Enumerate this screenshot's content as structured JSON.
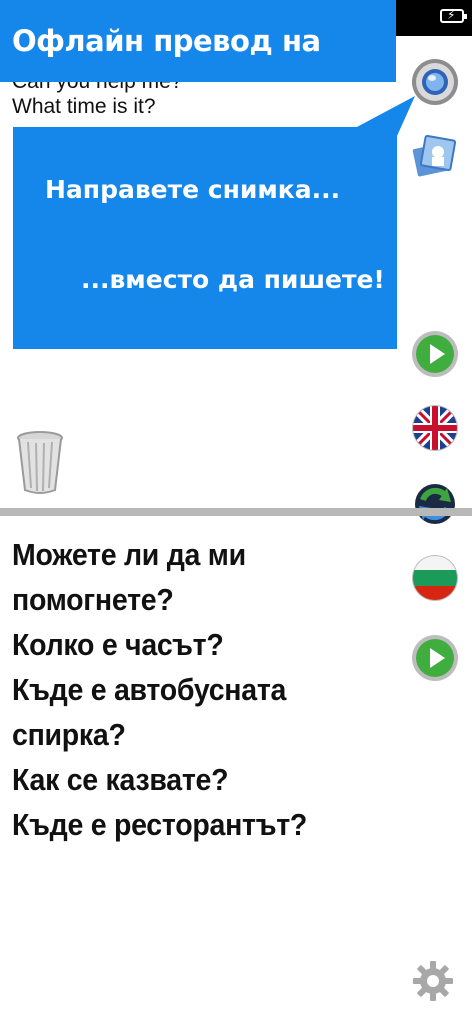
{
  "status_bar": {
    "battery_icon": "battery-charging-icon"
  },
  "source": {
    "lines": [
      "Can you help me?",
      "What time is it?"
    ]
  },
  "promo": {
    "title": "Офлайн превод на снимки",
    "bubble_line1": "Направете снимка...",
    "bubble_line2": "...вместо да пишете!",
    "color": "#1687ea"
  },
  "translation": {
    "lines": [
      "Можете ли да ми",
      "помогнете?",
      "Колко е часът?",
      "Къде е автобусната",
      "спирка?",
      "Как се казвате?",
      "Къде е ресторантът?"
    ]
  },
  "icons": {
    "camera": "camera-icon",
    "gallery": "gallery-icon",
    "play": "play-icon",
    "uk_flag": "uk-flag-icon",
    "swap": "swap-icon",
    "bg_flag": "bulgaria-flag-icon",
    "trash": "trash-icon",
    "settings": "gear-icon"
  }
}
